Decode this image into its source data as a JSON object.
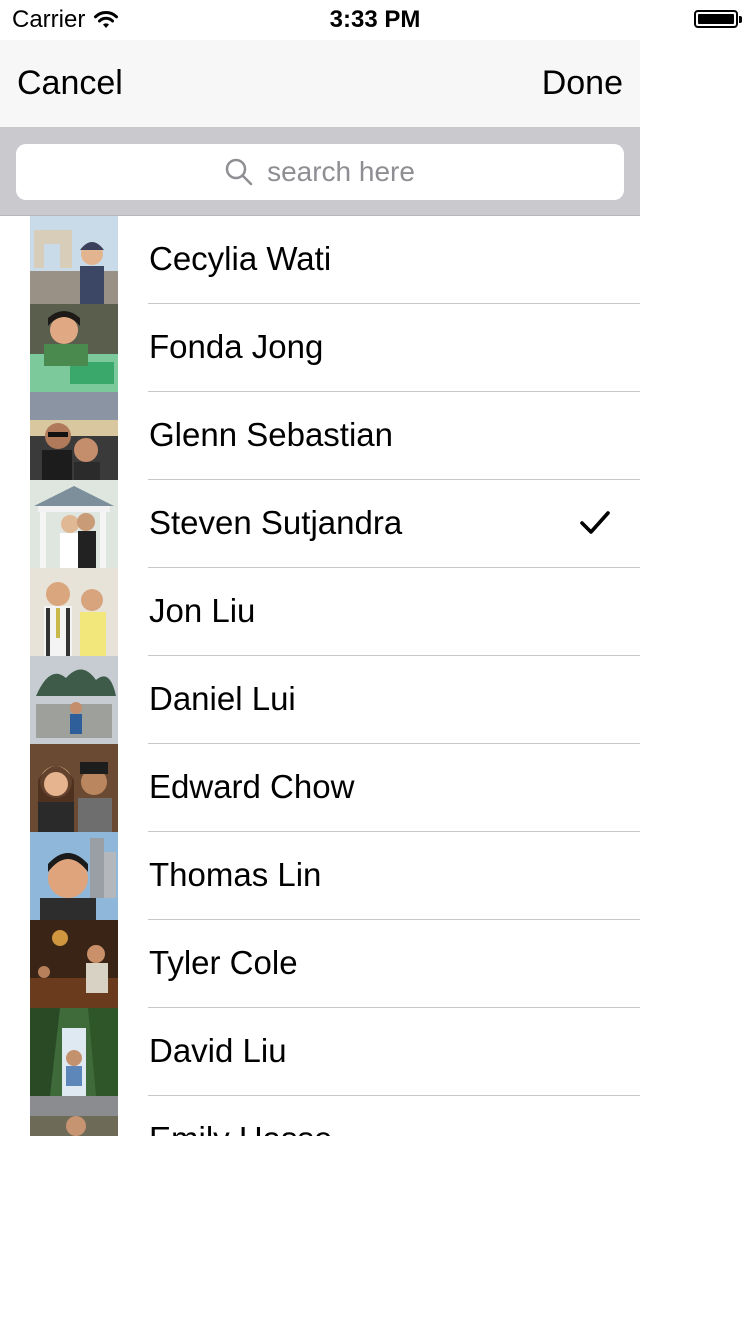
{
  "status_bar": {
    "carrier": "Carrier",
    "time": "3:33 PM"
  },
  "nav": {
    "cancel_label": "Cancel",
    "done_label": "Done"
  },
  "search": {
    "placeholder": "search here"
  },
  "contacts": [
    {
      "name": "Cecylia Wati",
      "selected": false
    },
    {
      "name": "Fonda Jong",
      "selected": false
    },
    {
      "name": "Glenn Sebastian",
      "selected": false
    },
    {
      "name": "Steven Sutjandra",
      "selected": true
    },
    {
      "name": "Jon Liu",
      "selected": false
    },
    {
      "name": "Daniel Lui",
      "selected": false
    },
    {
      "name": "Edward Chow",
      "selected": false
    },
    {
      "name": "Thomas Lin",
      "selected": false
    },
    {
      "name": "Tyler Cole",
      "selected": false
    },
    {
      "name": "David Liu",
      "selected": false
    },
    {
      "name": "Emily Hasse",
      "selected": false
    }
  ]
}
